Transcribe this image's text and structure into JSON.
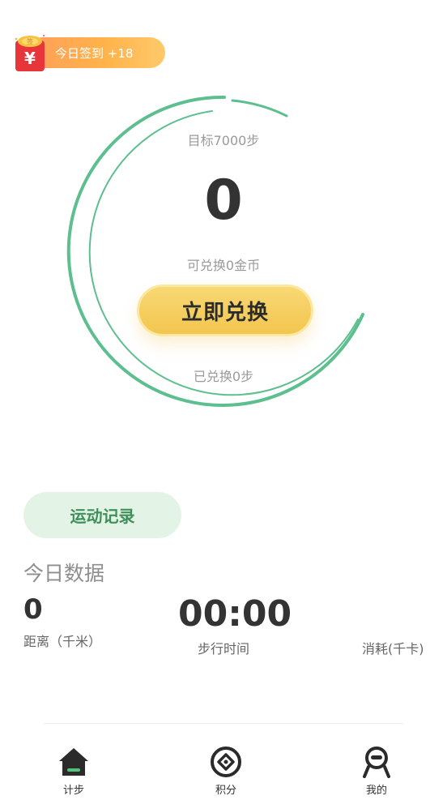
{
  "signin": {
    "label": "今日签到 +18",
    "badge_glyph": "¥",
    "lid_glyph": "签",
    "color_start": "#ff9f5a",
    "color_end": "#ffc96a",
    "envelope_color": "#e8353a"
  },
  "ring": {
    "accent_color": "#5dbf8f",
    "goal_text": "目标7000步",
    "steps_value": "0",
    "coins_text": "可兑换0金币",
    "redeem_label": "立即兑换",
    "redeemed_text": "已兑换0步"
  },
  "record": {
    "label": "运动记录"
  },
  "today": {
    "title": "今日数据",
    "distance_value": "0",
    "distance_label": "距离（千米）",
    "time_value": "00:00",
    "time_label": "步行时间",
    "calories_label": "消耗(千卡)"
  },
  "nav": {
    "items": [
      {
        "label": "计步",
        "icon": "house-icon",
        "active": true
      },
      {
        "label": "积分",
        "icon": "coin-icon",
        "active": false
      },
      {
        "label": "我的",
        "icon": "profile-icon",
        "active": false
      }
    ]
  }
}
